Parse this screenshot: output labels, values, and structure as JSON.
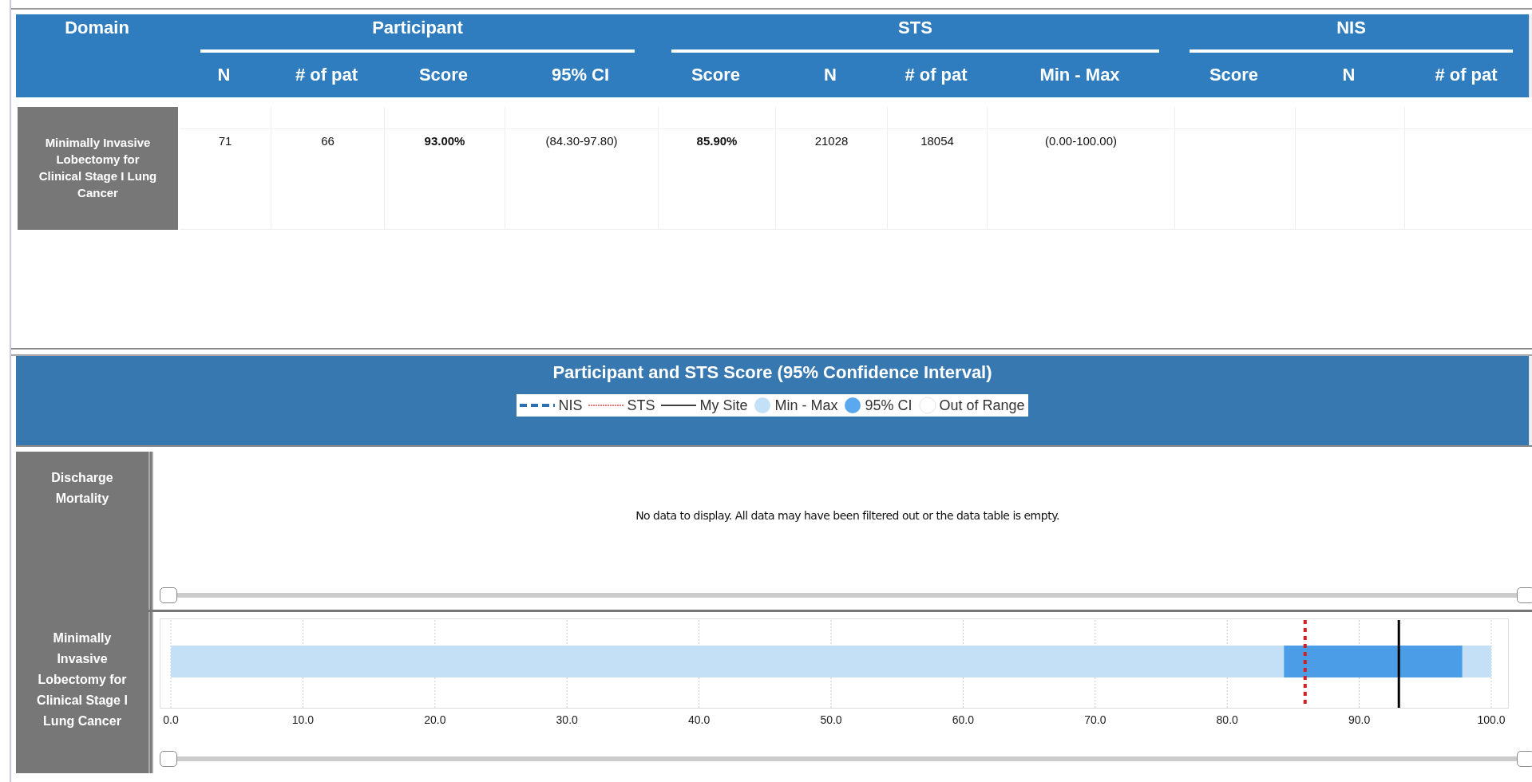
{
  "table": {
    "domain_header": "Domain",
    "groups": [
      {
        "label": "Participant",
        "columns": [
          "N",
          "# of pat",
          "Score",
          "95% CI"
        ]
      },
      {
        "label": "STS",
        "columns": [
          "Score",
          "N",
          "# of pat",
          "Min - Max"
        ]
      },
      {
        "label": "NIS",
        "columns": [
          "Score",
          "N",
          "# of pat"
        ]
      }
    ],
    "rows": [
      {
        "domain": "Minimally Invasive Lobectomy for Clinical Stage I Lung Cancer",
        "cells": [
          {
            "text": "71",
            "bold": false
          },
          {
            "text": "66",
            "bold": false
          },
          {
            "text": "93.00%",
            "bold": true
          },
          {
            "text": "(84.30-97.80)",
            "bold": false
          },
          {
            "text": "85.90%",
            "bold": true
          },
          {
            "text": "21028",
            "bold": false
          },
          {
            "text": "18054",
            "bold": false
          },
          {
            "text": "(0.00-100.00)",
            "bold": false
          }
        ]
      }
    ]
  },
  "chart_panel": {
    "title": "Participant and STS Score (95% Confidence Interval)",
    "legend": [
      {
        "label": "NIS",
        "kind": "dashed-line",
        "color": "#2e6fb0"
      },
      {
        "label": "STS",
        "kind": "dotted-line",
        "color": "#e07878"
      },
      {
        "label": "My Site",
        "kind": "solid-line",
        "color": "#404040"
      },
      {
        "label": "Min - Max",
        "kind": "circle",
        "color": "#c4e0f7"
      },
      {
        "label": "95% CI",
        "kind": "circle",
        "color": "#5aa8ee"
      },
      {
        "label": "Out of Range",
        "kind": "circle",
        "color": "#ffffff"
      }
    ],
    "rows": [
      {
        "label": "Discharge Mortality",
        "kind": "message",
        "message": "No data to display. All data may have been filtered out or the data table is empty."
      },
      {
        "kind": "chart",
        "chart_data": {
          "type": "bar",
          "orientation": "horizontal",
          "categories": [
            "Minimally Invasive Lobectomy for Clinical Stage I Lung Cancer"
          ],
          "xlim": [
            0,
            100
          ],
          "grid": true,
          "xticks": [
            {
              "value": 0,
              "label": "0.0"
            },
            {
              "value": 10,
              "label": "10.0"
            },
            {
              "value": 20,
              "label": "20.0"
            },
            {
              "value": 30,
              "label": "30.0"
            },
            {
              "value": 40,
              "label": "40.0"
            },
            {
              "value": 50,
              "label": "50.0"
            },
            {
              "value": 60,
              "label": "60.0"
            },
            {
              "value": 70,
              "label": "70.0"
            },
            {
              "value": 80,
              "label": "80.0"
            },
            {
              "value": 90,
              "label": "90.0"
            },
            {
              "value": 100,
              "label": "100.0"
            }
          ],
          "bands": [
            {
              "axis": "x",
              "from": 0,
              "to": 100,
              "color": "#c4e0f7"
            },
            {
              "axis": "x",
              "from": 84.3,
              "to": 97.8,
              "color": "#4a9de6"
            }
          ],
          "ref_lines": [
            {
              "axis": "x",
              "value": 85.9,
              "color": "#d42020"
            },
            {
              "axis": "x",
              "value": 93.0,
              "color": "#000000"
            }
          ]
        }
      }
    ]
  }
}
